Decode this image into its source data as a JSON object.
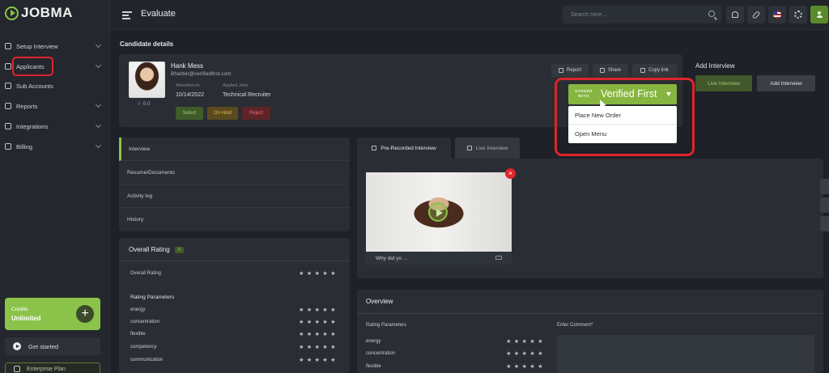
{
  "app": {
    "logo_text": "JOBMA",
    "page_title": "Evaluate"
  },
  "sidebar": {
    "items": [
      {
        "label": "Setup Interview",
        "icon": "setup-icon"
      },
      {
        "label": "Applicants",
        "icon": "applicants-icon"
      },
      {
        "label": "Sub Accounts",
        "icon": "sub-accounts-icon"
      },
      {
        "label": "Reports",
        "icon": "reports-icon"
      },
      {
        "label": "Integrations",
        "icon": "integrations-icon"
      },
      {
        "label": "Billing",
        "icon": "billing-icon"
      }
    ],
    "credits_label": "Credits",
    "credits_value": "Unlimited",
    "get_started": "Get started",
    "plan_label": "Enterprise Plan"
  },
  "header": {
    "search_placeholder": "Search here..."
  },
  "candidate": {
    "section_title": "Candidate details",
    "name": "Hank Mess",
    "email": "Bharbin@verifiedfirst.com",
    "attended_label": "Attended on",
    "attended_value": "10/14/2022",
    "applied_label": "Applied Jobs",
    "applied_value": "Technical Recruiter",
    "rating": "☆ 0.0",
    "btn_select": "Select",
    "btn_hold": "On Hold",
    "btn_reject": "Reject",
    "btn_report": "Report",
    "btn_share": "Share",
    "btn_copy": "Copy link"
  },
  "add_interview": {
    "title": "Add Interview",
    "live": "Live Interview",
    "add": "Add Interview"
  },
  "verified_first": {
    "screen_with": "SCREEN WITH",
    "brand": "Verified First",
    "menu": [
      "Place New Order",
      "Open Menu"
    ]
  },
  "side_tabs": [
    "Interview",
    "Resume/Documents",
    "Activity log",
    "History"
  ],
  "overall_rating": {
    "title": "Overall Rating",
    "badge": "0",
    "row_label": "Overall Rating",
    "params_title": "Rating Parameters",
    "params": [
      "energy",
      "concentration",
      "flexible",
      "competency",
      "communication"
    ],
    "stars": "★★★★★"
  },
  "interview_tabs": {
    "pre": "Pre-Recorded Interview",
    "live": "Live Interview"
  },
  "video": {
    "caption": "Why did yo ..."
  },
  "overview": {
    "title": "Overview",
    "params_title": "Rating Parameters",
    "comment_label": "Enter Comment*",
    "params": [
      "energy",
      "concentration",
      "flexible"
    ]
  },
  "colors": {
    "accent": "#8bc34a",
    "annotation_red": "#e0242c"
  }
}
